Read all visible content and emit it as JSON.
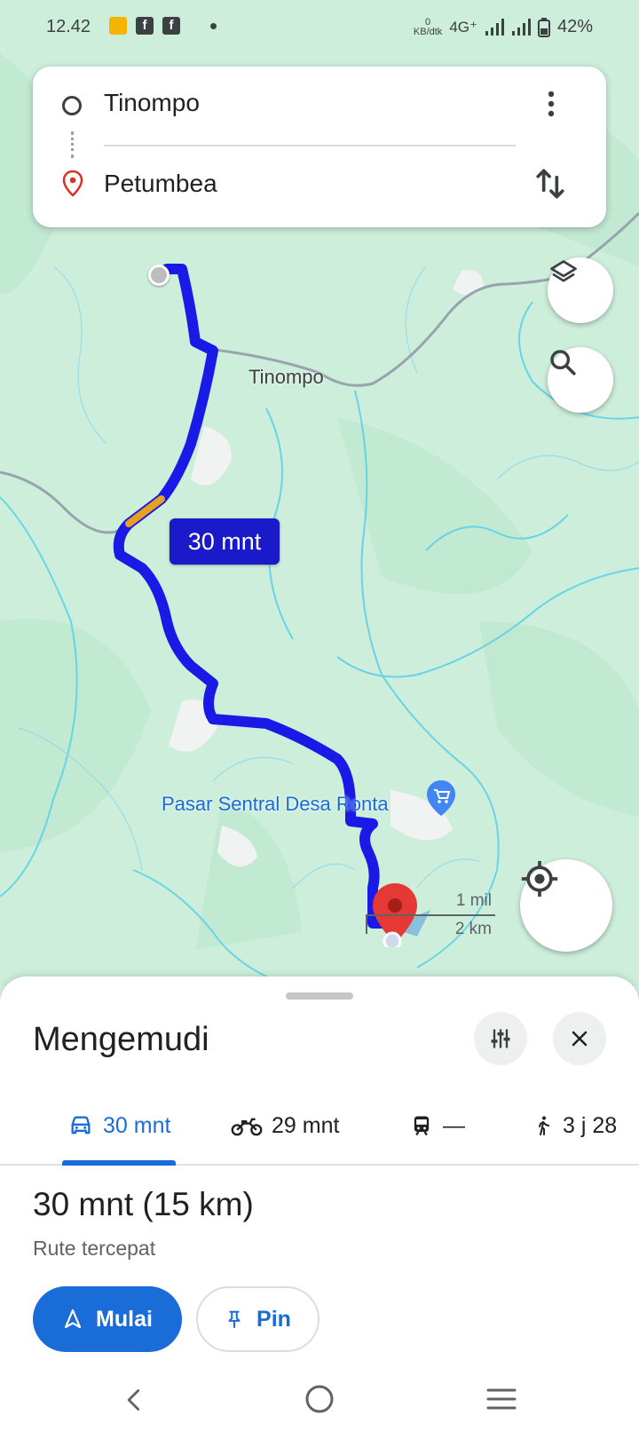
{
  "status_bar": {
    "time": "12.42",
    "net_speed_value": "0",
    "net_speed_unit": "KB/dtk",
    "network": "4G⁺",
    "battery": "42%"
  },
  "search": {
    "origin": "Tinompo",
    "destination": "Petumbea"
  },
  "map": {
    "place_label": "Tinompo",
    "poi_label": "Pasar Sentral Desa Ronta",
    "duration_bubble": "30 mnt",
    "scale_mi": "1 mil",
    "scale_km": "2 km",
    "colors": {
      "route": "#1a1ae6",
      "traffic": "#e8a020",
      "destination_pin": "#e53935",
      "poi_label": "#1a6cd9"
    }
  },
  "sheet": {
    "title": "Mengemudi",
    "tabs": [
      {
        "icon": "car-icon",
        "label": "30 mnt"
      },
      {
        "icon": "motorcycle-icon",
        "label": "29 mnt"
      },
      {
        "icon": "train-icon",
        "label": "—"
      },
      {
        "icon": "walk-icon",
        "label": "3 j 28"
      }
    ],
    "duration": "30 mnt (15 km)",
    "route_desc": "Rute tercepat",
    "start_label": "Mulai",
    "pin_label": "Pin"
  },
  "colors": {
    "accent": "#1a6cd9"
  }
}
